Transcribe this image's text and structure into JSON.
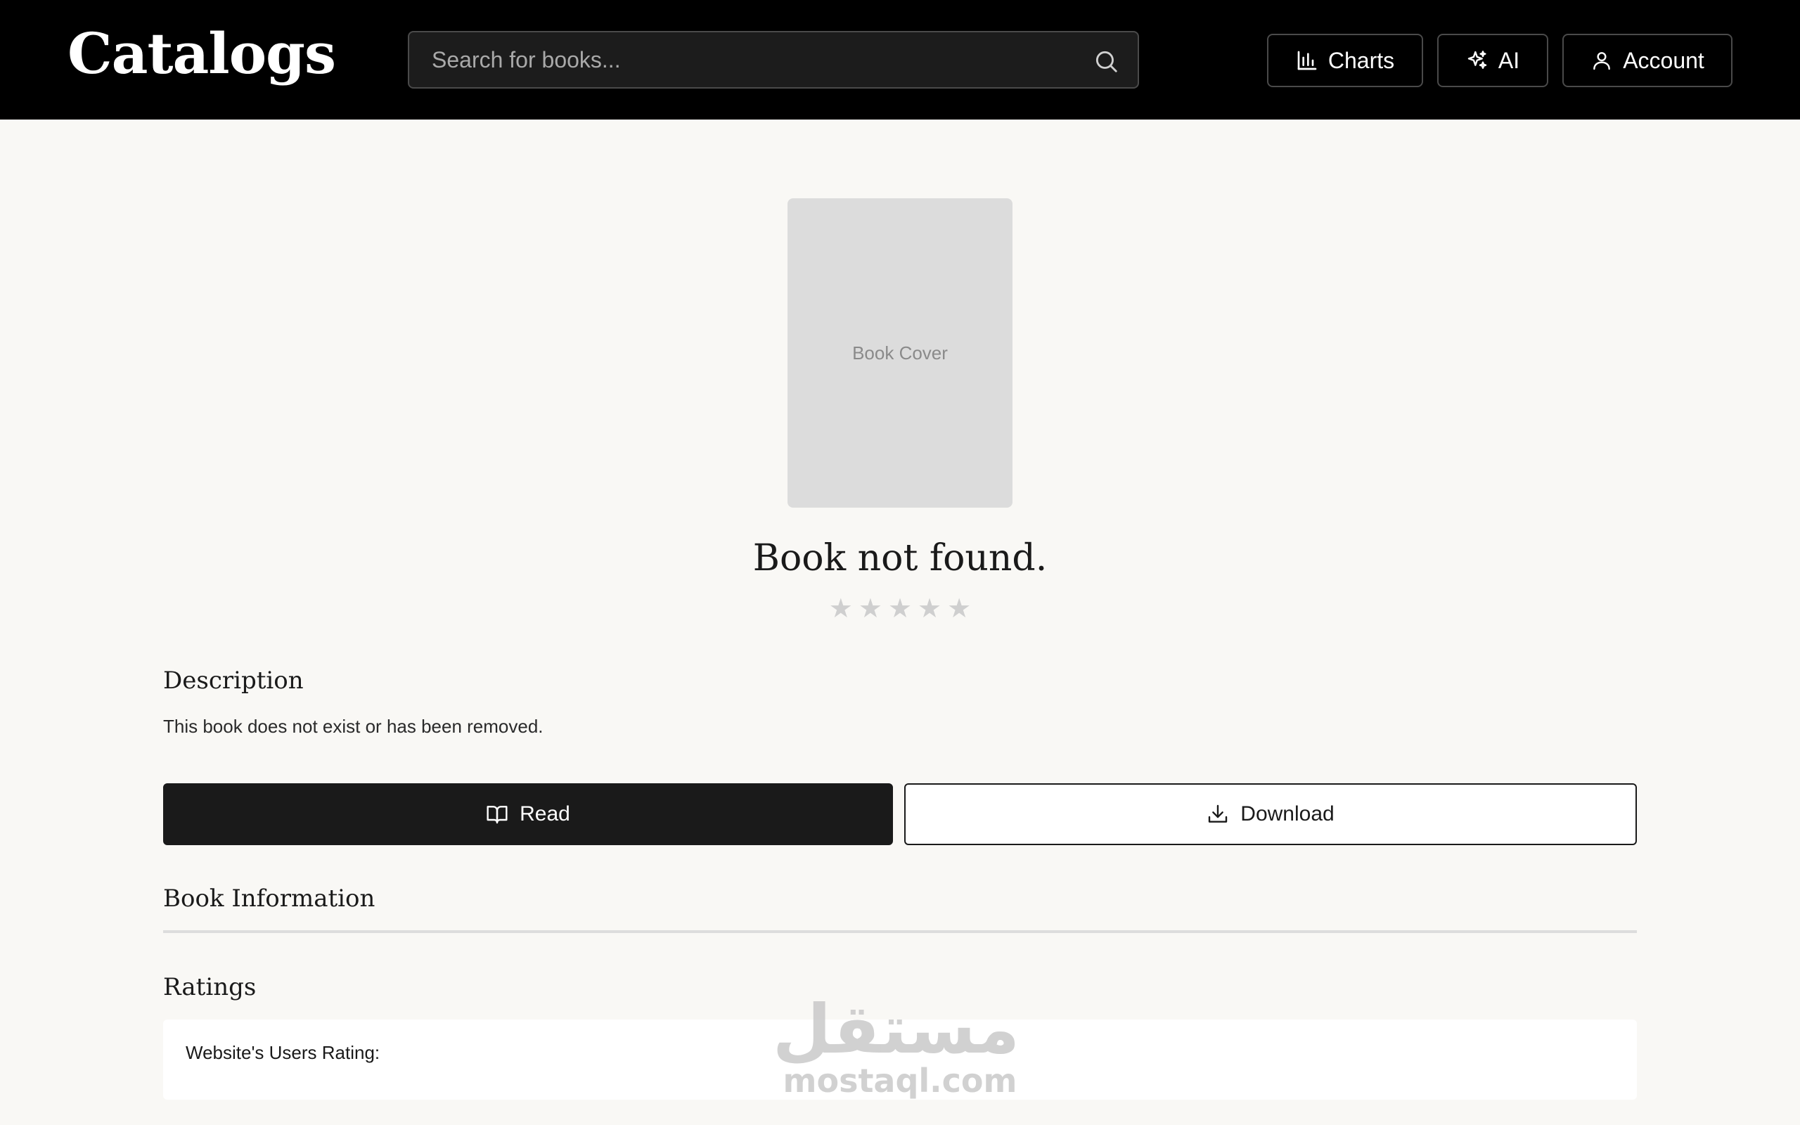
{
  "header": {
    "brand": "Catalogs",
    "search_placeholder": "Search for books...",
    "nav": {
      "charts": "Charts",
      "ai": "AI",
      "account": "Account"
    }
  },
  "book": {
    "cover_label": "Book Cover",
    "title": "Book not found.",
    "rating": {
      "value": 0,
      "max": 5
    }
  },
  "description": {
    "heading": "Description",
    "text": "This book does not exist or has been removed."
  },
  "actions": {
    "read": "Read",
    "download": "Download"
  },
  "info": {
    "heading": "Book Information"
  },
  "ratings": {
    "heading": "Ratings",
    "users_rating_label": "Website's Users Rating:"
  },
  "watermark": {
    "arabic": "مستقل",
    "latin": "mostaql.com"
  },
  "colors": {
    "header_bg": "#000000",
    "page_bg": "#f9f8f5",
    "primary_button": "#1a1a1a",
    "star_inactive": "#cfcfcf"
  }
}
